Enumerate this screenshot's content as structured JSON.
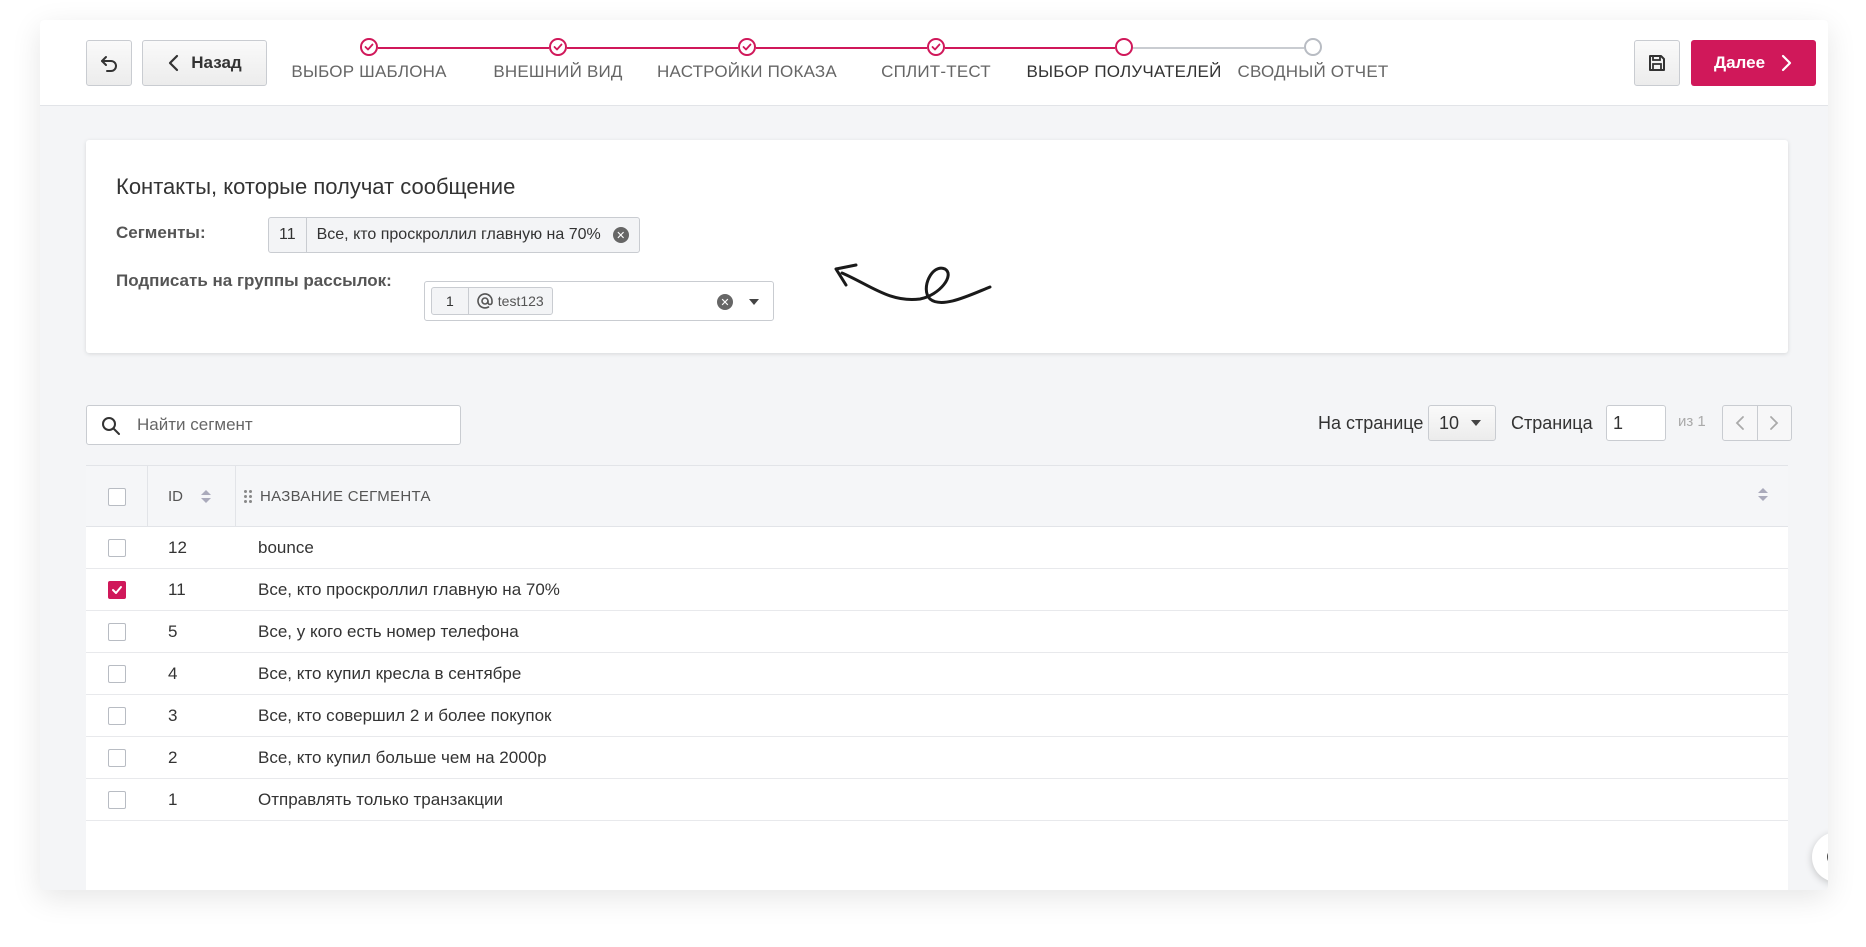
{
  "toolbar": {
    "back_label": "Назад",
    "next_label": "Далее",
    "accent_color": "#d0185a"
  },
  "steps": [
    {
      "label": "ВЫБОР ШАБЛОНА",
      "state": "done"
    },
    {
      "label": "ВНЕШНИЙ ВИД",
      "state": "done"
    },
    {
      "label": "НАСТРОЙКИ ПОКАЗА",
      "state": "done"
    },
    {
      "label": "СПЛИТ-ТЕСТ",
      "state": "done"
    },
    {
      "label": "ВЫБОР ПОЛУЧАТЕЛЕЙ",
      "state": "current"
    },
    {
      "label": "СВОДНЫЙ ОТЧЕТ",
      "state": "pending"
    }
  ],
  "card": {
    "title": "Контакты, которые получат сообщение",
    "segments_label": "Сегменты:",
    "segment_tag": {
      "id": "11",
      "name": "Все, кто проскроллил главную на 70%"
    },
    "groups_label": "Подписать на группы рассылок:",
    "group_tag": {
      "count": "1",
      "name": "test123"
    }
  },
  "search": {
    "placeholder": "Найти сегмент"
  },
  "pager": {
    "per_page_label": "На странице",
    "per_page_value": "10",
    "page_label": "Страница",
    "page_value": "1",
    "of_label": "из 1"
  },
  "table": {
    "columns": {
      "id": "ID",
      "name": "НАЗВАНИЕ СЕГМЕНТА"
    },
    "rows": [
      {
        "id": "12",
        "name": "bounce",
        "checked": false
      },
      {
        "id": "11",
        "name": "Все, кто проскроллил главную на 70%",
        "checked": true
      },
      {
        "id": "5",
        "name": "Все, у кого есть номер телефона",
        "checked": false
      },
      {
        "id": "4",
        "name": "Все, кто купил кресла в сентябре",
        "checked": false
      },
      {
        "id": "3",
        "name": "Все, кто совершил 2 и более покупок",
        "checked": false
      },
      {
        "id": "2",
        "name": "Все, кто купил больше чем на 2000р",
        "checked": false
      },
      {
        "id": "1",
        "name": "Отправлять только транзакции",
        "checked": false
      }
    ]
  }
}
